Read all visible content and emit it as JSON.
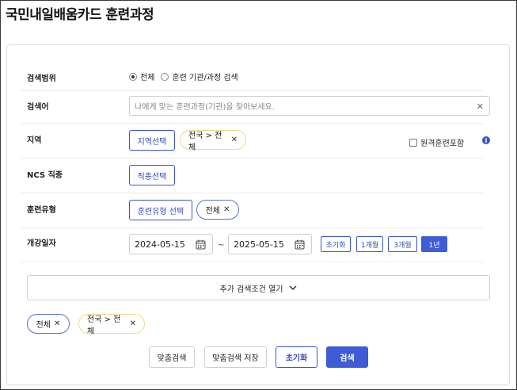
{
  "page": {
    "title": "국민내일배움카드 훈련과정"
  },
  "form": {
    "scope": {
      "label": "검색범위",
      "options": [
        {
          "label": "전체",
          "selected": true
        },
        {
          "label": "훈련 기관/과정 검색",
          "selected": false
        }
      ]
    },
    "keyword": {
      "label": "검색어",
      "placeholder": "나에게 맞는 훈련과정(기관)을 찾아보세요.",
      "clear_icon": "close-icon"
    },
    "region": {
      "label": "지역",
      "button_label": "지역선택",
      "chip_label": "전국 > 전체",
      "remote_label": "원격훈련포함",
      "remote_checked": false,
      "info_icon": "i"
    },
    "ncs": {
      "label": "NCS 직종",
      "button_label": "직종선택"
    },
    "training_type": {
      "label": "훈련유형",
      "button_label": "훈련유형 선택",
      "chip_label": "전체"
    },
    "start_date": {
      "label": "개강일자",
      "from": "2024-05-15",
      "separator": "~",
      "to": "2025-05-15",
      "quick_buttons": [
        {
          "label": "초기화",
          "active": false
        },
        {
          "label": "1개월",
          "active": false
        },
        {
          "label": "3개월",
          "active": false
        },
        {
          "label": "1년",
          "active": true
        }
      ]
    },
    "more_conditions_label": "추가 검색조건 열기"
  },
  "selected_filters": [
    {
      "label": "전체",
      "color": "#5b6fcf"
    },
    {
      "label": "전국 > 전체",
      "color": "#f1d98f"
    }
  ],
  "actions": {
    "custom_search": "맞춤검색",
    "save_custom_search": "맞춤검색 저장",
    "reset": "초기화",
    "search": "검색"
  },
  "colors": {
    "accent": "#3f5bd6",
    "chip_yellow": "#f1d98f"
  }
}
